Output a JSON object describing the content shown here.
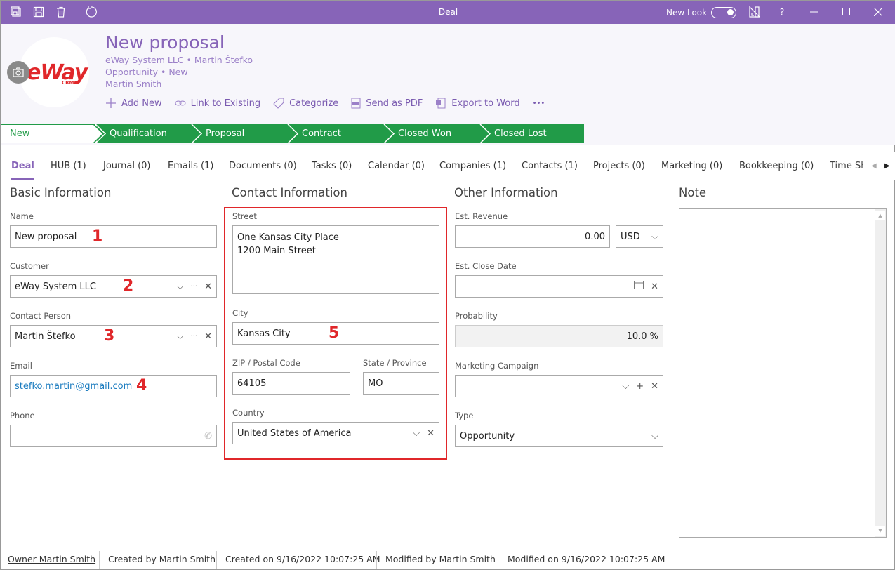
{
  "window": {
    "title": "Deal",
    "new_look_label": "New Look",
    "new_look_on": true,
    "toolbar_icons": [
      "save-and-close-icon",
      "save-icon",
      "delete-icon",
      "refresh-icon"
    ],
    "right_icons": [
      "layout-icon",
      "help-icon",
      "minimize-icon",
      "maximize-icon",
      "close-icon"
    ],
    "help_glyph": "?"
  },
  "header": {
    "title": "New proposal",
    "subtitle_line1": "eWay System LLC  •  Martin Štefko",
    "subtitle_line2": "Opportunity  •  New",
    "subtitle_line3": "Martin Smith",
    "logo_text": "eWay",
    "logo_sub": "CRM",
    "actions": [
      {
        "label": "Add New",
        "icon": "plus-icon"
      },
      {
        "label": "Link to Existing",
        "icon": "link-icon"
      },
      {
        "label": "Categorize",
        "icon": "tag-icon"
      },
      {
        "label": "Send as PDF",
        "icon": "pdf-icon"
      },
      {
        "label": "Export to Word",
        "icon": "word-icon"
      }
    ],
    "more": "•••"
  },
  "pipeline": {
    "stages": [
      "New",
      "Qualification",
      "Proposal",
      "Contract",
      "Closed Won",
      "Closed Lost"
    ],
    "current": "New",
    "color": "#219b48"
  },
  "tabs": [
    "Deal",
    "HUB (1)",
    "Journal (0)",
    "Emails (1)",
    "Documents (0)",
    "Tasks (0)",
    "Calendar (0)",
    "Companies (1)",
    "Contacts (1)",
    "Projects (0)",
    "Marketing (0)",
    "Bookkeeping (0)",
    "Time Sh"
  ],
  "basic": {
    "title": "Basic Information",
    "name_label": "Name",
    "name_value": "New proposal",
    "customer_label": "Customer",
    "customer_value": "eWay System LLC",
    "contact_label": "Contact Person",
    "contact_value": "Martin Štefko",
    "email_label": "Email",
    "email_value": "stefko.martin@gmail.com",
    "phone_label": "Phone",
    "phone_value": ""
  },
  "contact": {
    "title": "Contact Information",
    "street_label": "Street",
    "street_line1": "One Kansas City Place",
    "street_line2": "1200 Main Street",
    "city_label": "City",
    "city_value": "Kansas City",
    "zip_label": "ZIP / Postal Code",
    "zip_value": "64105",
    "state_label": "State / Province",
    "state_value": "MO",
    "country_label": "Country",
    "country_value": "United States of America"
  },
  "other": {
    "title": "Other Information",
    "revenue_label": "Est. Revenue",
    "revenue_value": "0.00",
    "currency": "USD",
    "close_label": "Est. Close Date",
    "close_value": "",
    "prob_label": "Probability",
    "prob_value": "10.0 %",
    "campaign_label": "Marketing Campaign",
    "campaign_value": "",
    "type_label": "Type",
    "type_value": "Opportunity"
  },
  "note": {
    "title": "Note",
    "value": ""
  },
  "annotations": [
    "1",
    "2",
    "3",
    "4",
    "5"
  ],
  "footer": {
    "owner": "Owner Martin Smith",
    "created_by": "Created by Martin Smith",
    "created_on": "Created on 9/16/2022 10:07:25 AM",
    "modified_by": "Modified by Martin Smith",
    "modified_on": "Modified on 9/16/2022 10:07:25 AM"
  }
}
